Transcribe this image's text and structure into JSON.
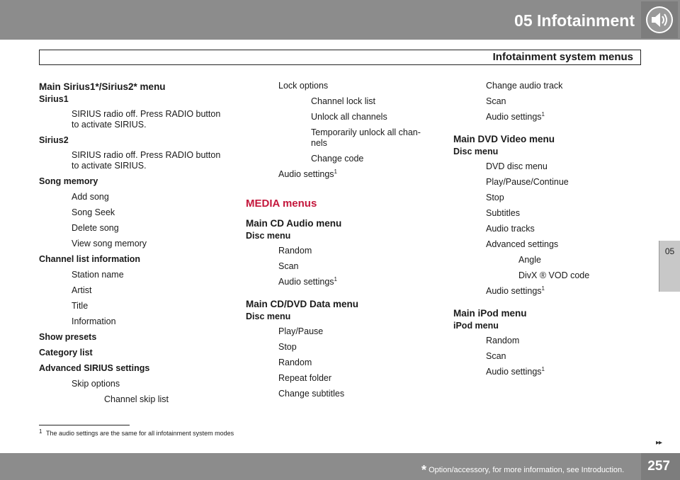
{
  "header": {
    "chapter": "05  Infotainment",
    "subtitle": "Infotainment system menus",
    "side_tab": "05"
  },
  "footnote": {
    "num": "1",
    "text": "The audio settings are the same for all infotainment system modes"
  },
  "footer": {
    "note": "Option/accessory, for more information, see Introduction.",
    "page": "257",
    "continue": "▸▸"
  },
  "colors": {
    "header_bg": "#8c8c8c",
    "accent": "#c4173c",
    "tab_bg": "#c8c8c8"
  },
  "column1": [
    {
      "kind": "h-menu",
      "level": 0,
      "text": "Main Sirius1*/Sirius2* menu",
      "gap": 0
    },
    {
      "kind": "h-sub",
      "level": 0,
      "text": "Sirius1",
      "gap": 0
    },
    {
      "kind": "item",
      "level": 1,
      "text": "SIRIUS radio off. Press RADIO button to activate SIRIUS.",
      "gap": 6
    },
    {
      "kind": "h-sub",
      "level": 0,
      "text": "Sirius2",
      "gap": 6
    },
    {
      "kind": "item",
      "level": 1,
      "text": "SIRIUS radio off. Press RADIO button to activate SIRIUS.",
      "gap": 6
    },
    {
      "kind": "h-sub",
      "level": 0,
      "text": "Song memory",
      "gap": 6
    },
    {
      "kind": "item",
      "level": 1,
      "text": "Add song",
      "gap": 7
    },
    {
      "kind": "item",
      "level": 1,
      "text": "Song Seek",
      "gap": 7
    },
    {
      "kind": "item",
      "level": 1,
      "text": "Delete song",
      "gap": 7
    },
    {
      "kind": "item",
      "level": 1,
      "text": "View song memory",
      "gap": 7
    },
    {
      "kind": "h-sub",
      "level": 0,
      "text": "Channel list information",
      "gap": 6
    },
    {
      "kind": "item",
      "level": 1,
      "text": "Station name",
      "gap": 7
    },
    {
      "kind": "item",
      "level": 1,
      "text": "Artist",
      "gap": 7
    },
    {
      "kind": "item",
      "level": 1,
      "text": "Title",
      "gap": 7
    },
    {
      "kind": "item",
      "level": 1,
      "text": "Information",
      "gap": 7
    },
    {
      "kind": "h-sub",
      "level": 0,
      "text": "Show presets",
      "gap": 6
    },
    {
      "kind": "h-sub",
      "level": 0,
      "text": "Category list",
      "gap": 6
    },
    {
      "kind": "h-sub",
      "level": 0,
      "text": "Advanced SIRIUS settings",
      "gap": 6
    },
    {
      "kind": "item",
      "level": 1,
      "text": "Skip options",
      "gap": 7
    },
    {
      "kind": "item",
      "level": 2,
      "text": "Channel skip list",
      "gap": 7
    }
  ],
  "column2": [
    {
      "kind": "item",
      "level": 1,
      "text": "Lock options",
      "gap": 0
    },
    {
      "kind": "item",
      "level": 2,
      "text": "Channel lock list",
      "gap": 7
    },
    {
      "kind": "item",
      "level": 2,
      "text": "Unlock all channels",
      "gap": 7
    },
    {
      "kind": "item",
      "level": 2,
      "text": "Temporarily unlock all chan- nels",
      "gap": 7
    },
    {
      "kind": "item",
      "level": 2,
      "text": "Change code",
      "gap": 7
    },
    {
      "kind": "item",
      "level": 1,
      "text": "Audio settings",
      "sup": "1",
      "gap": 7
    },
    {
      "kind": "h-media",
      "level": 0,
      "text": "MEDIA menus",
      "gap": 25
    },
    {
      "kind": "h-menu",
      "level": 0,
      "text": "Main CD Audio menu",
      "gap": 10
    },
    {
      "kind": "h-sub",
      "level": 0,
      "text": "Disc menu",
      "gap": 0
    },
    {
      "kind": "item",
      "level": 1,
      "text": "Random",
      "gap": 6
    },
    {
      "kind": "item",
      "level": 1,
      "text": "Scan",
      "gap": 7
    },
    {
      "kind": "item",
      "level": 1,
      "text": "Audio settings",
      "sup": "1",
      "gap": 7
    },
    {
      "kind": "h-menu",
      "level": 0,
      "text": "Main CD/DVD Data menu",
      "gap": 15
    },
    {
      "kind": "h-sub",
      "level": 0,
      "text": "Disc menu",
      "gap": 0
    },
    {
      "kind": "item",
      "level": 1,
      "text": "Play/Pause",
      "gap": 6
    },
    {
      "kind": "item",
      "level": 1,
      "text": "Stop",
      "gap": 7
    },
    {
      "kind": "item",
      "level": 1,
      "text": "Random",
      "gap": 7
    },
    {
      "kind": "item",
      "level": 1,
      "text": "Repeat folder",
      "gap": 7
    },
    {
      "kind": "item",
      "level": 1,
      "text": "Change subtitles",
      "gap": 7
    }
  ],
  "column3": [
    {
      "kind": "item",
      "level": 1,
      "text": "Change audio track",
      "gap": 0
    },
    {
      "kind": "item",
      "level": 1,
      "text": "Scan",
      "gap": 7
    },
    {
      "kind": "item",
      "level": 1,
      "text": "Audio settings",
      "sup": "1",
      "gap": 7
    },
    {
      "kind": "h-menu",
      "level": 0,
      "text": "Main DVD Video menu",
      "gap": 15
    },
    {
      "kind": "h-sub",
      "level": 0,
      "text": "Disc menu",
      "gap": 0
    },
    {
      "kind": "item",
      "level": 1,
      "text": "DVD disc menu",
      "gap": 6
    },
    {
      "kind": "item",
      "level": 1,
      "text": "Play/Pause/Continue",
      "gap": 7
    },
    {
      "kind": "item",
      "level": 1,
      "text": "Stop",
      "gap": 7
    },
    {
      "kind": "item",
      "level": 1,
      "text": "Subtitles",
      "gap": 7
    },
    {
      "kind": "item",
      "level": 1,
      "text": "Audio tracks",
      "gap": 7
    },
    {
      "kind": "item",
      "level": 1,
      "text": "Advanced settings",
      "gap": 7
    },
    {
      "kind": "item",
      "level": 2,
      "text": "Angle",
      "gap": 7
    },
    {
      "kind": "item",
      "level": 2,
      "text": "DivX ® VOD code",
      "gap": 7
    },
    {
      "kind": "item",
      "level": 1,
      "text": "Audio settings",
      "sup": "1",
      "gap": 7
    },
    {
      "kind": "h-menu",
      "level": 0,
      "text": "Main iPod menu",
      "gap": 15
    },
    {
      "kind": "h-sub",
      "level": 0,
      "text": "iPod menu",
      "gap": 0
    },
    {
      "kind": "item",
      "level": 1,
      "text": "Random",
      "gap": 6
    },
    {
      "kind": "item",
      "level": 1,
      "text": "Scan",
      "gap": 7
    },
    {
      "kind": "item",
      "level": 1,
      "text": "Audio settings",
      "sup": "1",
      "gap": 7
    }
  ]
}
